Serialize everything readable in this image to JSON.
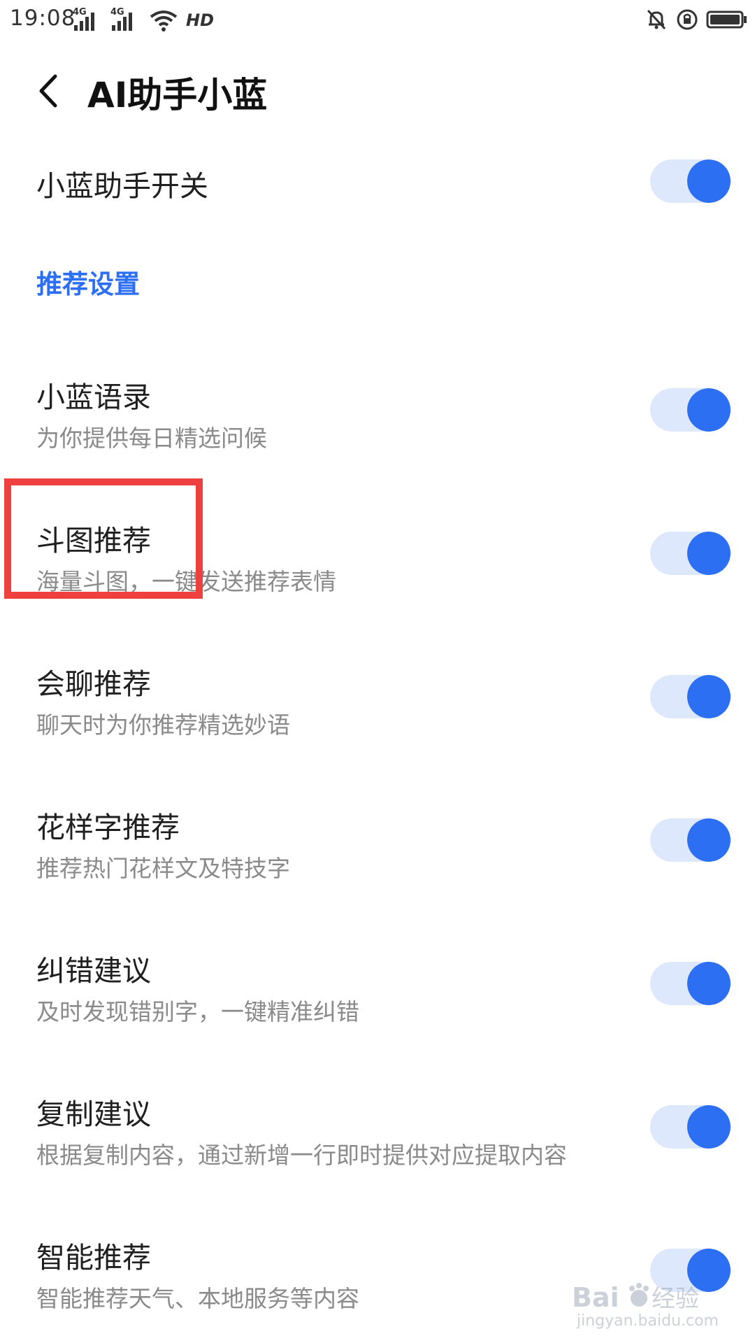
{
  "status_bar": {
    "time": "19:08",
    "network_1": "4G",
    "network_2": "4G",
    "hd_label": "HD"
  },
  "header": {
    "title": "AI助手小蓝"
  },
  "master_switch": {
    "label": "小蓝助手开关",
    "on": true
  },
  "section": {
    "title": "推荐设置"
  },
  "settings": [
    {
      "title": "小蓝语录",
      "subtitle": "为你提供每日精选问候",
      "on": true
    },
    {
      "title": "斗图推荐",
      "subtitle": "海量斗图，一键发送推荐表情",
      "on": true
    },
    {
      "title": "会聊推荐",
      "subtitle": "聊天时为你推荐精选妙语",
      "on": true
    },
    {
      "title": "花样字推荐",
      "subtitle": "推荐热门花样文及特技字",
      "on": true
    },
    {
      "title": "纠错建议",
      "subtitle": "及时发现错别字，一键精准纠错",
      "on": true
    },
    {
      "title": "复制建议",
      "subtitle": "根据复制内容，通过新增一行即时提供对应提取内容",
      "on": true
    },
    {
      "title": "智能推荐",
      "subtitle": "智能推荐天气、本地服务等内容",
      "on": true
    }
  ],
  "colors": {
    "accent": "#2d6ff2",
    "track": "#dde8fc",
    "highlight": "#ef3f3f"
  },
  "watermark": {
    "text": "jingyan.baidu.com"
  }
}
